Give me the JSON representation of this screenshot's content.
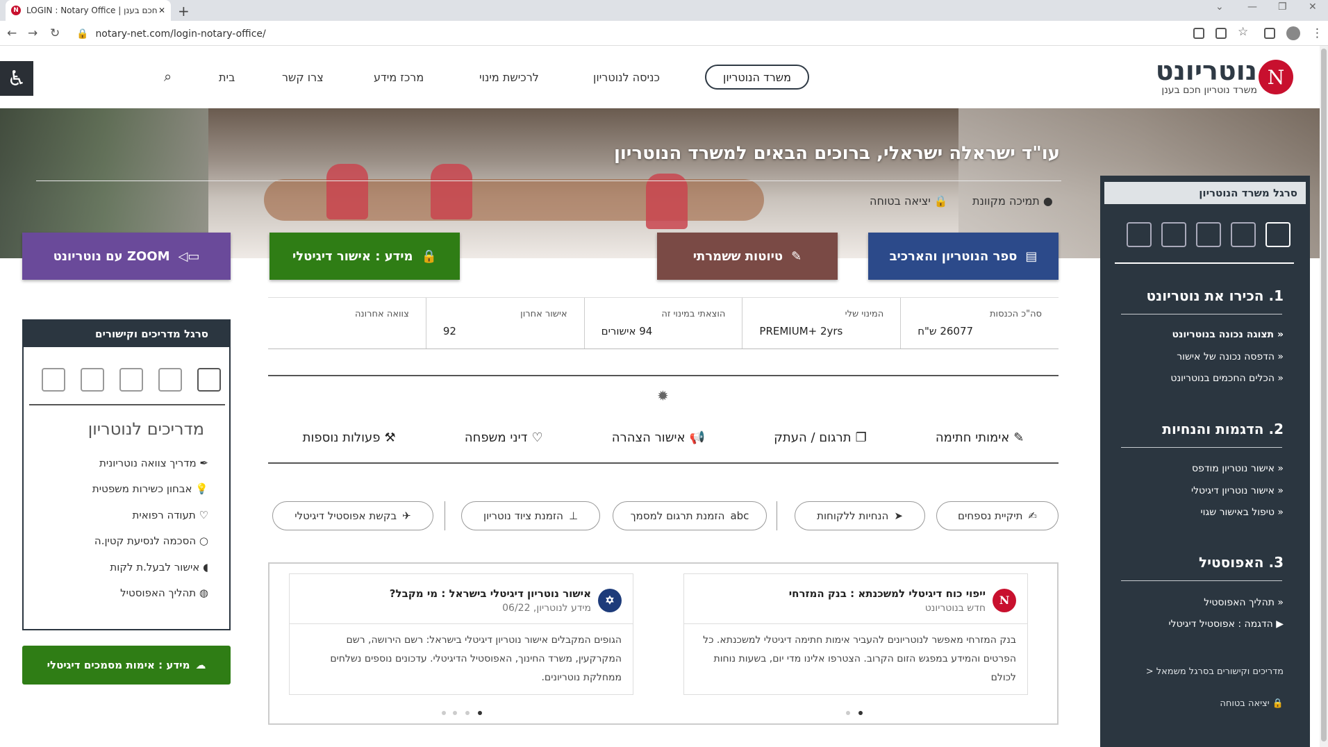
{
  "browser": {
    "tab_title": "LOGIN : Notary Office | נוטריון חכם בענן",
    "url": "notary-net.com/login-notary-office/",
    "new_tab": "+",
    "fav": "N"
  },
  "header": {
    "logo_letter": "N",
    "logo_text": "נוטריונט",
    "logo_sub": "משרד נוטריון חכם בענן",
    "nav": [
      "בית",
      "צרו קשר",
      "מרכז מידע",
      "לרכישת מינוי",
      "כניסה לנוטריון"
    ],
    "pill": "משרד הנוטריון",
    "access_icon": "♿",
    "search_icon": "⌕"
  },
  "hero": {
    "title": "עו\"ד ישראלה ישראלי, ברוכים הבאים למשרד הנוטריון",
    "support": "תמיכה מקוונת",
    "logout": "יציאה בטוחה"
  },
  "buttons": {
    "book": "ספר הנוטריון והארכיב",
    "drafts": "טיוטות ששמרתי",
    "info": "מידע : אישור דיגיטלי",
    "zoom": "ZOOM עם נוטריונט"
  },
  "stats": [
    {
      "label": "סה\"כ הכנסות",
      "value": "26077 ש\"ח"
    },
    {
      "label": "המינוי שלי",
      "value": "PREMIUM+ 2yrs"
    },
    {
      "label": "הוצאתי במינוי זה",
      "value": "94 אישורים"
    },
    {
      "label": "אישור אחרון",
      "value": "92"
    },
    {
      "label": "צוואה אחרונה",
      "value": ""
    }
  ],
  "tabs": [
    "אימותי חתימה",
    "תרגום / העתק",
    "אישור הצהרה",
    "דיני משפחה",
    "פעולות נוספות"
  ],
  "pills": [
    "תיקיית נספחים",
    "הנחיות ללקוחות",
    "הזמנת תרגום למסמך",
    "הזמנת ציוד נוטריון",
    "בקשת אפוסטיל דיגיטלי"
  ],
  "cards": [
    {
      "icon": "N",
      "title": "ייפוי כוח דיגיטלי למשכנתא : בנק המזרחי",
      "sub": "חדש בנוטריונט",
      "body": "בנק המזרחי מאפשר לנוטריונים להעביר אימות חתימה דיגיטלי למשכנתא. כל הפרטים והמידע במפגש הזום הקרוב. הצטרפו אלינו מדי יום, בשעות נוחות לכולם"
    },
    {
      "icon": "✡",
      "title": "אישור נוטריון דיגיטלי בישראל : מי מקבל?",
      "sub": "מידע לנוטריון, 06/22",
      "body": "הגופים המקבלים אישור נוטריון דיגיטלי בישראל: רשם הירושה, רשם המקרקעין, משרד החינוך, האפוסטיל הדיגיטלי. עדכונים נוספים נשלחים ממחלקת נוטריונים."
    }
  ],
  "right_sidebar": {
    "head": "סרגל משרד הנוטריון",
    "sec1": "1. הכירו את נוטריונט",
    "sec1_items": [
      "תצוגה נכונה בנוטריונט",
      "הדפסה נכונה של אישור",
      "הכלים החכמים בנוטריונט"
    ],
    "sec2": "2. הדגמות והנחיות",
    "sec2_items": [
      "אישור נוטריון מודפס",
      "אישור נוטריון דיגיטלי",
      "טיפול באישור שגוי"
    ],
    "sec3": "3. האפוסטיל",
    "sec3_items": [
      "תהליך האפוסטיל",
      "הדגמה : אפוסטיל דיגיטלי"
    ],
    "bottom_link": "מדריכים וקישורים בסרגל משמאל <",
    "logout": "יציאה בטוחה"
  },
  "left_sidebar": {
    "head": "סרגל מדריכים וקישורים",
    "title": "מדריכים לנוטריון",
    "items": [
      "מדריך צוואה נוטריונית",
      "אבחון כשירות משפטית",
      "תעודה רפואית",
      "הסכמה לנסיעת קטין.ה",
      "אישור לבעל.ת לקות",
      "תהליך האפוסטיל"
    ],
    "green_btn": "מידע : אימות מסמכים דיגיטלי"
  },
  "colors": {
    "navy": "#2b3640",
    "blue_btn": "#2c4a8a",
    "brown_btn": "#7a4a45",
    "green_btn": "#2f7d15",
    "purple_btn": "#6a4a9a",
    "brand_red": "#c8102e"
  }
}
